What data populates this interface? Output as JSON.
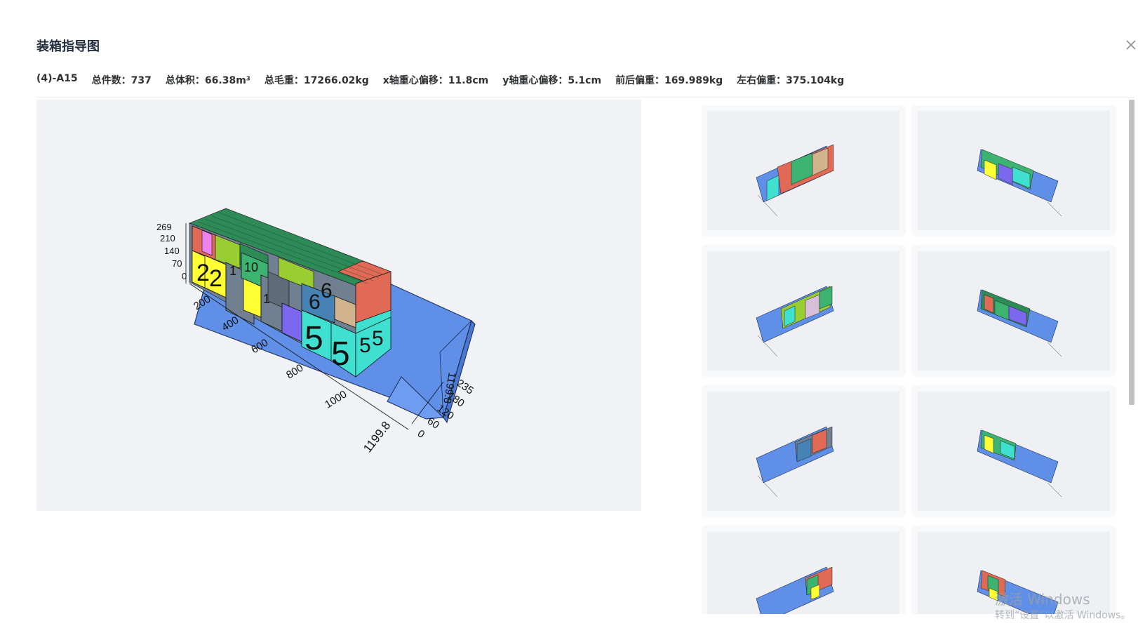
{
  "dialog": {
    "title": "装箱指导图"
  },
  "stats": [
    "(4)-A15",
    "总件数：737",
    "总体积：66.38m³",
    "总毛重：17266.02kg",
    "x轴重心偏移：11.8cm",
    "y轴重心偏移：5.1cm",
    "前后偏重：169.989kg",
    "左右偏重：375.104kg"
  ],
  "main_view": {
    "z_ticks": [
      "269",
      "210",
      "140",
      "70",
      "0"
    ],
    "length_ticks": [
      "200",
      "400",
      "600",
      "800",
      "1000",
      "1199.8"
    ],
    "width_ticks": [
      "0",
      "60",
      "120",
      "180",
      "235"
    ],
    "end_label": "1199.8",
    "box_numbers": [
      "2",
      "2",
      "1",
      "1",
      "10",
      "6",
      "6",
      "5",
      "5",
      "5",
      "5"
    ]
  },
  "colors": {
    "container": "#6495ed",
    "yellow": "#ffff33",
    "cyan": "#40e0d0",
    "brick": "#e06a55",
    "green": "#3cb371",
    "darkgreen": "#2e8b57",
    "gray": "#708090",
    "purple": "#7b68ee",
    "tan": "#d2b48c",
    "lime": "#9acd32",
    "pink": "#ee82ee",
    "steel": "#4682b4"
  },
  "watermark": {
    "line1": "激活 Windows",
    "line2": "转到“设置”以激活 Windows。"
  }
}
